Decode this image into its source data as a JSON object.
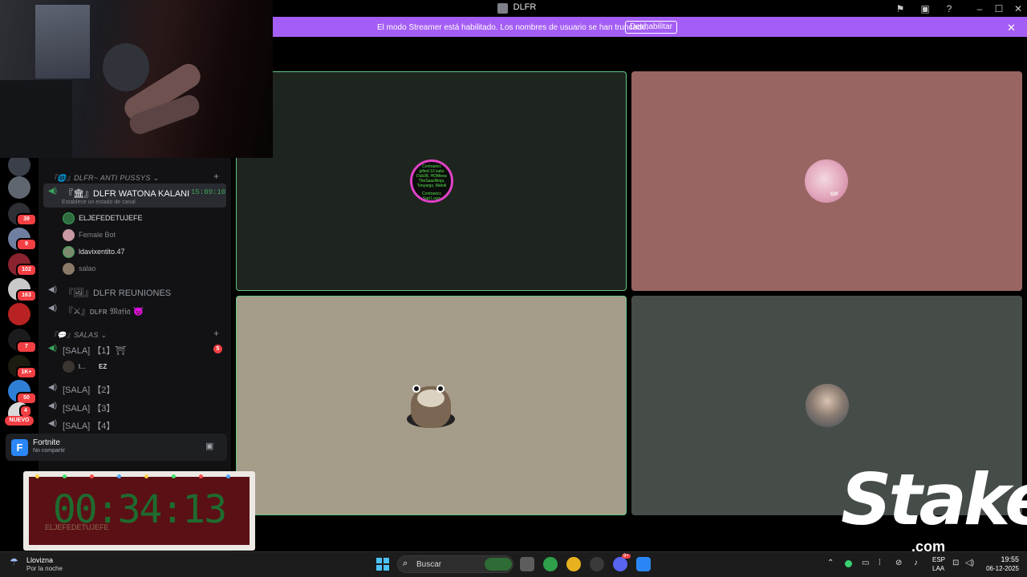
{
  "window": {
    "title": "DLFR"
  },
  "banner": {
    "text": "El modo Streamer está habilitado. Los nombres de usuario se han truncado.",
    "button": "Deshabilitar"
  },
  "server_badges": [
    "39",
    "9",
    "102",
    "163",
    "7",
    "1K+",
    "50",
    "4"
  ],
  "server_new_badge": "NUEVO",
  "sidebar": {
    "category1": "『🌐』DLFR~ ANTI PUSSYS ⌄",
    "active_channel": {
      "name": "『🏛』DLFR WATONA KALANI",
      "time": "15:09:10",
      "status": "Establece un estado de canal"
    },
    "members": [
      "ELJEFEDETUJEFE",
      "Female Bot",
      "ldavixentito.47",
      "salao"
    ],
    "channels": [
      "『🖼』DLFR REUNIONES",
      "『⚔』ᴅʟꜰʀ 𝔐𝔞𝔣𝔦𝔞 😈"
    ],
    "category2": "『💬』SALAS ⌄",
    "salas": [
      {
        "name": "[SALA] 【1】⛩",
        "badge": "5"
      },
      {
        "name": "[SALA] 【2】"
      },
      {
        "name": "[SALA] 【3】"
      },
      {
        "name": "[SALA] 【4】"
      }
    ],
    "sala1_member": {
      "name": "l...",
      "tag": "EZ"
    }
  },
  "activity": {
    "title": "Fortnite",
    "subtitle": "No compartir",
    "icon_letter": "F"
  },
  "timer": {
    "value": "00:34:13",
    "user": "ELJEFEDETUJEFE"
  },
  "tiles": {
    "tile1_lines": [
      "Contrastcc",
      "gifted 10 subs",
      "Dub38, HOMiess",
      "TheSaasNinja,",
      "Tonyargx, Mahdi",
      "",
      "Contrastcc",
      "Sad Louis"
    ],
    "tile2_gif": "GIF"
  },
  "logo": {
    "name": "Stake",
    "domain": ".com"
  },
  "taskbar": {
    "weather_title": "Llovizna",
    "weather_sub": "Por la noche",
    "search_placeholder": "Buscar",
    "lang_top": "ESP",
    "lang_bottom": "LAA",
    "time": "19:55",
    "date": "06-12-2025",
    "discord_badge": "9+"
  },
  "colors": {
    "accent_purple": "#a55ef5",
    "speaking_green": "#63c786",
    "badge_red": "#f23f43"
  }
}
